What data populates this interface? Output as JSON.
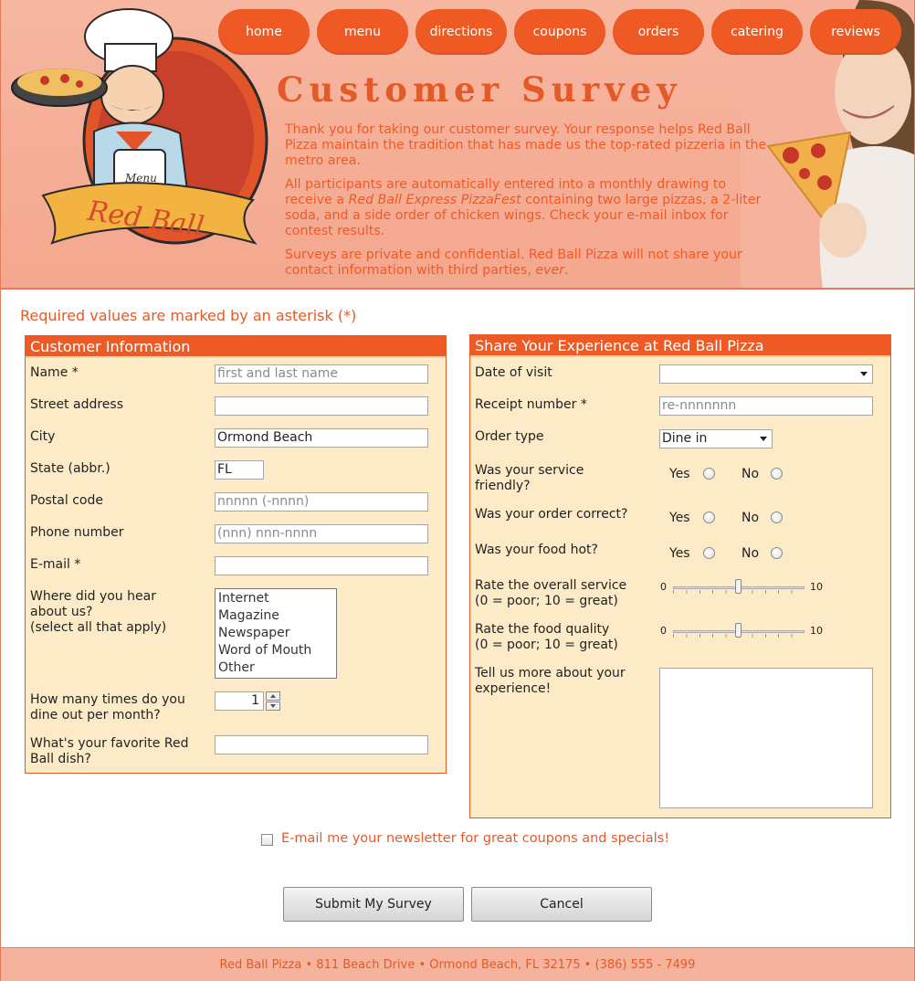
{
  "nav": [
    "home",
    "menu",
    "directions",
    "coupons",
    "orders",
    "catering",
    "reviews"
  ],
  "brand": {
    "logo_text": "Red Ball",
    "apron_text": "Menu"
  },
  "title": "Customer Survey",
  "intro": {
    "p1": "Thank you for taking our customer survey. Your response helps Red Ball Pizza maintain the tradition that has made us the top-rated pizzeria in the metro area.",
    "p2_before": "All participants are automatically entered into a monthly drawing to receive a ",
    "p2_em": "Red Ball Express PizzaFest",
    "p2_after": " containing two large pizzas, a 2-liter soda, and a side order of chicken wings. Check your e-mail inbox for contest results.",
    "p3_before": "Surveys are private and confidential. Red Ball Pizza will not share your contact information with third parties, ",
    "p3_em": "ever",
    "p3_after": "."
  },
  "required_note": "Required values are marked by an asterisk (*)",
  "customer": {
    "title": "Customer Information",
    "name": {
      "label": "Name *",
      "placeholder": "first and last name"
    },
    "street": {
      "label": "Street address",
      "value": ""
    },
    "city": {
      "label": "City",
      "value": "Ormond Beach"
    },
    "state": {
      "label": "State (abbr.)",
      "value": "FL"
    },
    "postal": {
      "label": "Postal code",
      "placeholder": "nnnnn (-nnnn)"
    },
    "phone": {
      "label": "Phone number",
      "placeholder": "(nnn) nnn-nnnn"
    },
    "email": {
      "label": "E-mail *",
      "value": ""
    },
    "hear": {
      "label_lines": [
        "Where did you hear",
        "about us?",
        "(select all that apply)"
      ],
      "options": [
        "Internet",
        "Magazine",
        "Newspaper",
        "Word of Mouth",
        "Other"
      ]
    },
    "dine": {
      "label_lines": [
        "How many times do you",
        "dine out per month?"
      ],
      "value": "1"
    },
    "favorite": {
      "label_lines": [
        "What's your favorite Red",
        "Ball dish?"
      ],
      "value": ""
    }
  },
  "experience": {
    "title": "Share Your Experience at Red Ball Pizza",
    "date": {
      "label": "Date of visit",
      "value": ""
    },
    "receipt": {
      "label": "Receipt number *",
      "placeholder": "re-nnnnnnn"
    },
    "order_type": {
      "label": "Order type",
      "value": "Dine in"
    },
    "friendly": {
      "label_lines": [
        "Was your service",
        "friendly?"
      ]
    },
    "correct": {
      "label": "Was your order correct?"
    },
    "hot": {
      "label": "Was your food hot?"
    },
    "yes": "Yes",
    "no": "No",
    "service_rating": {
      "label_lines": [
        "Rate the overall service",
        "(0 = poor; 10 = great)"
      ],
      "min": "0",
      "max": "10",
      "value": 5
    },
    "food_rating": {
      "label_lines": [
        "Rate the food quality",
        "(0 = poor; 10 = great)"
      ],
      "min": "0",
      "max": "10",
      "value": 5
    },
    "comments": {
      "label_lines": [
        "Tell us more about your",
        "experience!"
      ],
      "value": ""
    }
  },
  "newsletter": "E-mail me your newsletter for great coupons and specials!",
  "buttons": {
    "submit": "Submit My Survey",
    "cancel": "Cancel"
  },
  "footer": "Red Ball Pizza • 811 Beach Drive • Ormond Beach, FL 32175 • (386) 555 - 7499",
  "colors": {
    "accent": "#ef5a24",
    "header_bg": "#f5ad95",
    "panel_bg": "#fdebc7"
  }
}
